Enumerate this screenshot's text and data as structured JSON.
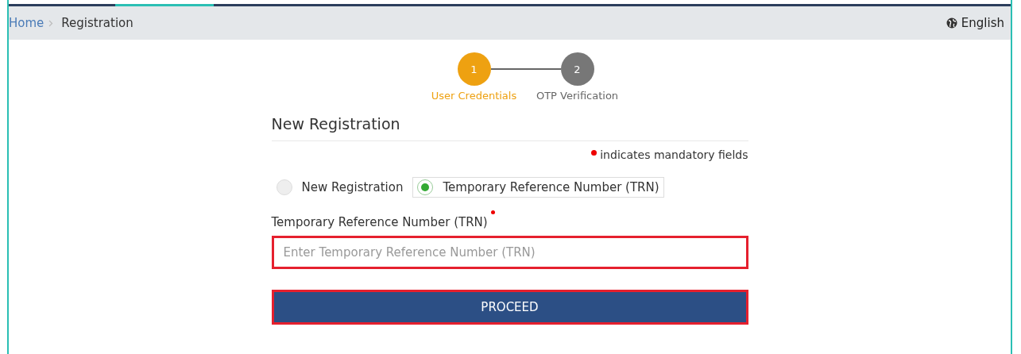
{
  "breadcrumb": [
    {
      "label": "Home",
      "kind": "link"
    },
    {
      "label": "Registration",
      "kind": "current"
    }
  ],
  "language": "English",
  "steps": [
    {
      "number": "1",
      "label": "User Credentials",
      "selected": true
    },
    {
      "number": "2",
      "label": "OTP Verification",
      "selected": false
    }
  ],
  "form": {
    "title": "New Registration",
    "mandatory_note": "indicates mandatory fields",
    "options": [
      {
        "label": "New Registration",
        "selected": false
      },
      {
        "label": "Temporary Reference Number (TRN)",
        "selected": true
      }
    ],
    "field": {
      "label": "Temporary Reference Number (TRN)",
      "required": true,
      "placeholder": "Enter Temporary Reference Number (TRN)"
    },
    "button": "PROCEED"
  }
}
